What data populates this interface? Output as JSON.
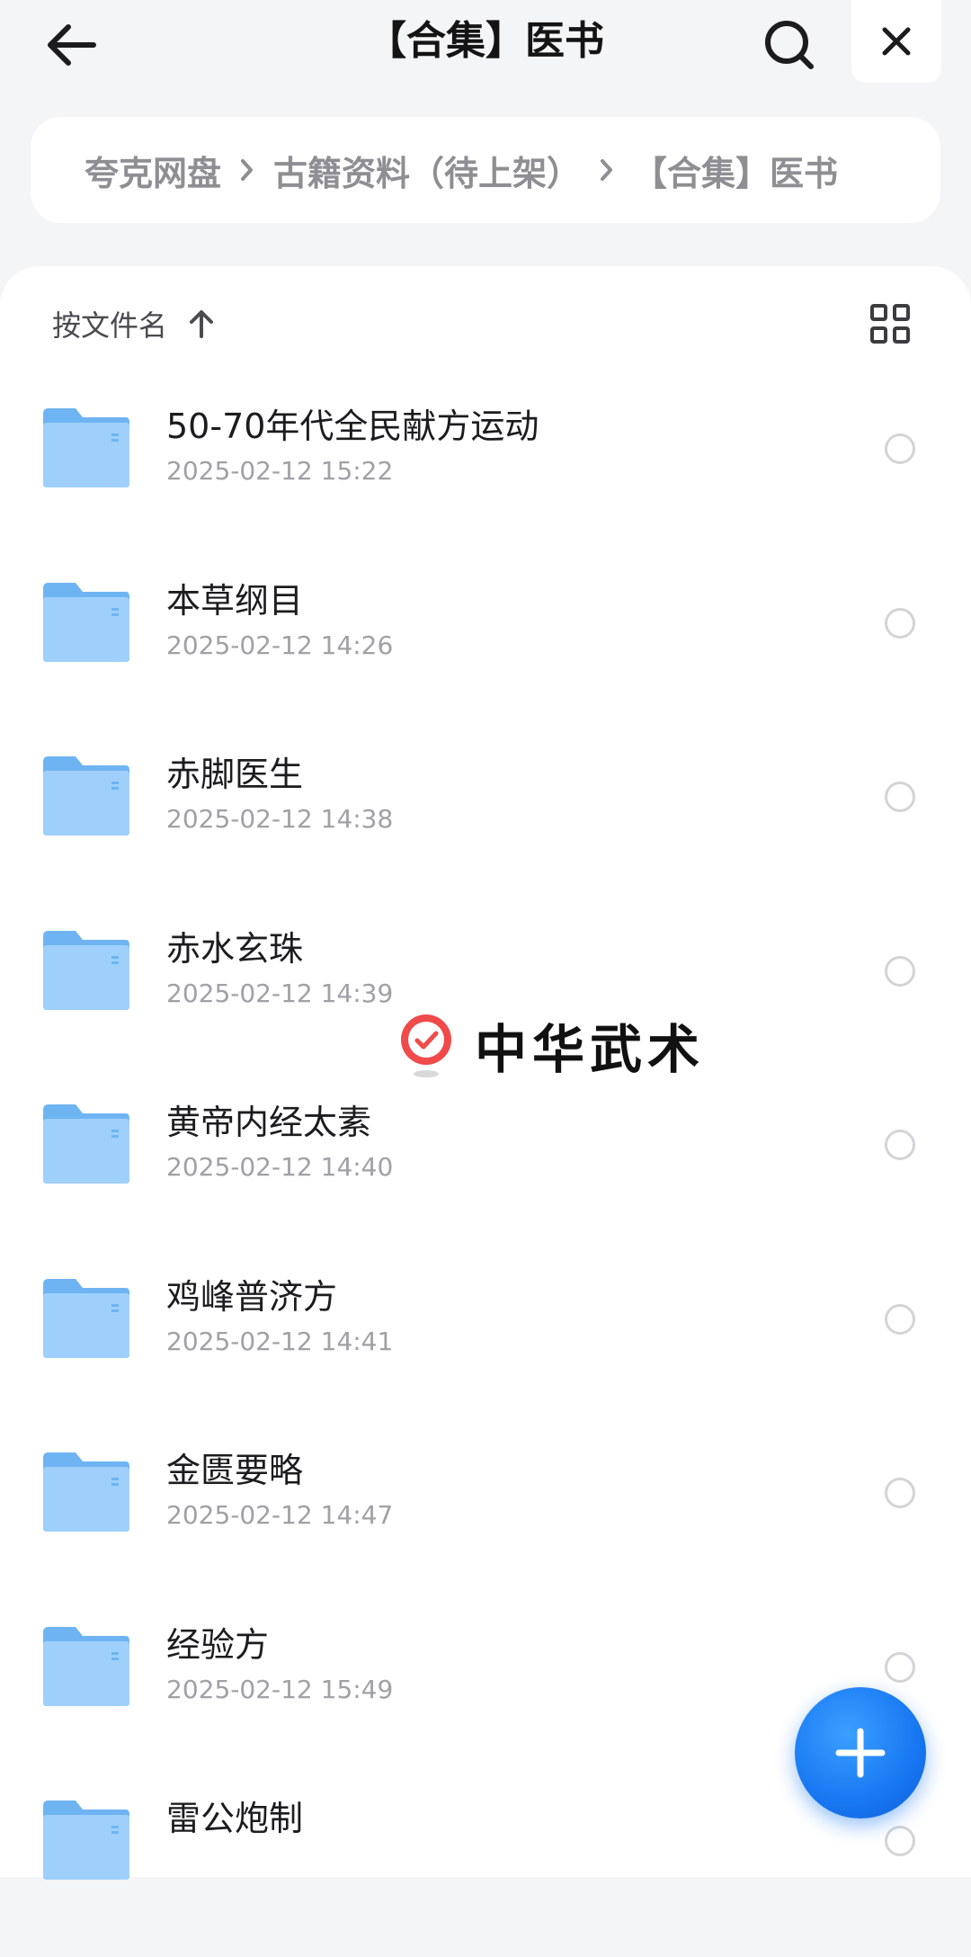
{
  "header": {
    "title": "【合集】医书"
  },
  "breadcrumb": {
    "items": [
      "夸克网盘",
      "古籍资料（待上架）",
      "【合集】医书"
    ]
  },
  "toolbar": {
    "sort_label": "按文件名"
  },
  "files": [
    {
      "name": "50-70年代全民献方运动",
      "date": "2025-02-12 15:22"
    },
    {
      "name": "本草纲目",
      "date": "2025-02-12 14:26"
    },
    {
      "name": "赤脚医生",
      "date": "2025-02-12 14:38"
    },
    {
      "name": "赤水玄珠",
      "date": "2025-02-12 14:39"
    },
    {
      "name": "黄帝内经太素",
      "date": "2025-02-12 14:40"
    },
    {
      "name": "鸡峰普济方",
      "date": "2025-02-12 14:41"
    },
    {
      "name": "金匮要略",
      "date": "2025-02-12 14:47"
    },
    {
      "name": "经验方",
      "date": "2025-02-12 15:49"
    },
    {
      "name": "雷公炮制",
      "date": ""
    }
  ],
  "watermark": {
    "text": "中华武术"
  },
  "icons": {
    "back": "arrow-left-icon",
    "search": "search-icon",
    "close": "close-icon",
    "sort": "arrow-up-icon",
    "view": "grid-view-icon",
    "folder": "folder-icon",
    "add": "plus-icon",
    "watermark": "checkmark-pin-icon"
  },
  "colors": {
    "background": "#f4f5f7",
    "folder": "#7cbcf6",
    "fab": "#1877f2",
    "secondary_text": "#a0a0a6"
  }
}
